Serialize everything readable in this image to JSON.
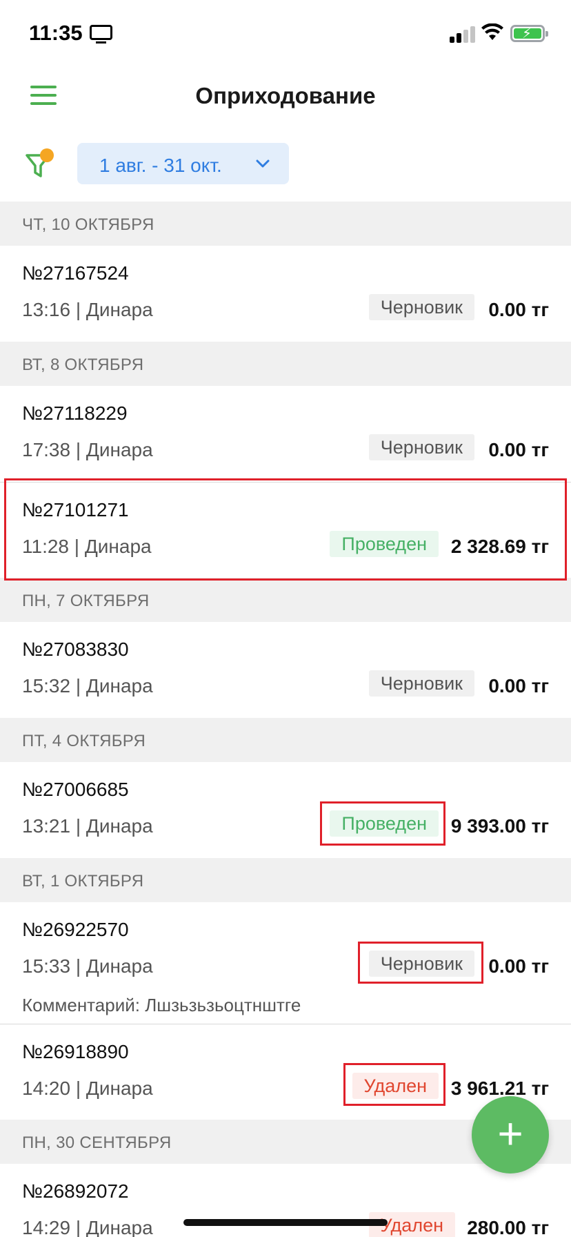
{
  "status_bar": {
    "time": "11:35"
  },
  "header": {
    "title": "Оприходование"
  },
  "filter": {
    "date_range": "1 авг. - 31 окт."
  },
  "icons": {
    "menu": "hamburger-menu-icon",
    "filter": "funnel-filter-icon",
    "chevron": "chevron-down-icon",
    "add": "plus-icon"
  },
  "colors": {
    "accent": "#4caf50",
    "link": "#2f7de1",
    "posted": "#46b065",
    "deleted": "#e0462f",
    "filter_dot": "#f5a623"
  },
  "sections": [
    {
      "header": "ЧТ, 10 ОКТЯБРЯ",
      "items": [
        {
          "number": "№27167524",
          "meta": "13:16 | Динара",
          "status": "Черновик",
          "status_type": "draft",
          "amount": "0.00 тг"
        }
      ]
    },
    {
      "header": "ВТ, 8 ОКТЯБРЯ",
      "items": [
        {
          "number": "№27118229",
          "meta": "17:38 | Динара",
          "status": "Черновик",
          "status_type": "draft",
          "amount": "0.00 тг"
        },
        {
          "number": "№27101271",
          "meta": "11:28 | Динара",
          "status": "Проведен",
          "status_type": "posted",
          "amount": "2 328.69 тг"
        }
      ]
    },
    {
      "header": "ПН, 7 ОКТЯБРЯ",
      "items": [
        {
          "number": "№27083830",
          "meta": "15:32 | Динара",
          "status": "Черновик",
          "status_type": "draft",
          "amount": "0.00 тг"
        }
      ]
    },
    {
      "header": "ПТ, 4 ОКТЯБРЯ",
      "items": [
        {
          "number": "№27006685",
          "meta": "13:21 | Динара",
          "status": "Проведен",
          "status_type": "posted",
          "amount": "9 393.00 тг"
        }
      ]
    },
    {
      "header": "ВТ, 1 ОКТЯБРЯ",
      "items": [
        {
          "number": "№26922570",
          "meta": "15:33 | Динара",
          "status": "Черновик",
          "status_type": "draft",
          "amount": "0.00 тг",
          "comment": "Комментарий: Лшзьзьзьоцтнштге"
        },
        {
          "number": "№26918890",
          "meta": "14:20 | Динара",
          "status": "Удален",
          "status_type": "deleted",
          "amount": "3 961.21 тг"
        }
      ]
    },
    {
      "header": "ПН, 30 СЕНТЯБРЯ",
      "items": [
        {
          "number": "№26892072",
          "meta": "14:29 | Динара",
          "status": "Удален",
          "status_type": "deleted",
          "amount": "280.00 тг"
        }
      ]
    }
  ]
}
